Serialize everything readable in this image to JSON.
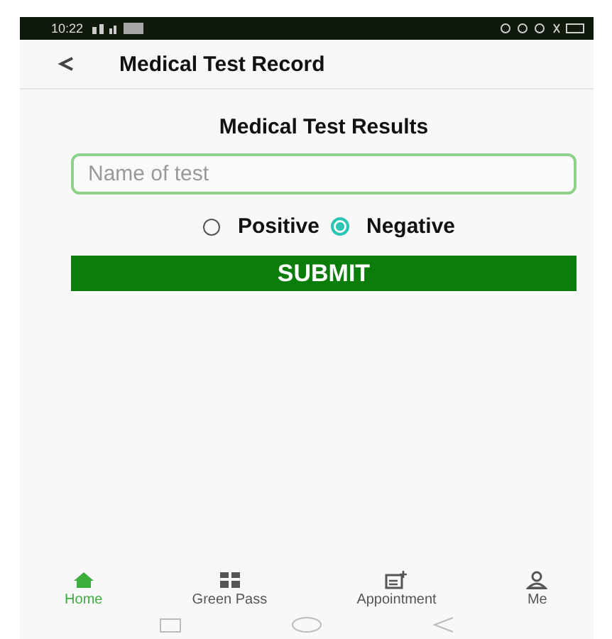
{
  "status_bar": {
    "time": "10:22"
  },
  "header": {
    "title": "Medical Test Record"
  },
  "form": {
    "heading": "Medical Test Results",
    "test_name": {
      "placeholder": "Name of test"
    },
    "result_options": [
      {
        "label": "Positive",
        "selected": false
      },
      {
        "label": "Negative",
        "selected": true
      }
    ],
    "submit": "SUBMIT"
  },
  "bottom_nav": [
    {
      "label": "Home",
      "kind": "home",
      "selected": true
    },
    {
      "label": "Green Pass",
      "kind": "pass",
      "selected": false
    },
    {
      "label": "Appointment",
      "kind": "appointment",
      "selected": false
    },
    {
      "label": "Me",
      "kind": "me",
      "selected": false
    }
  ]
}
